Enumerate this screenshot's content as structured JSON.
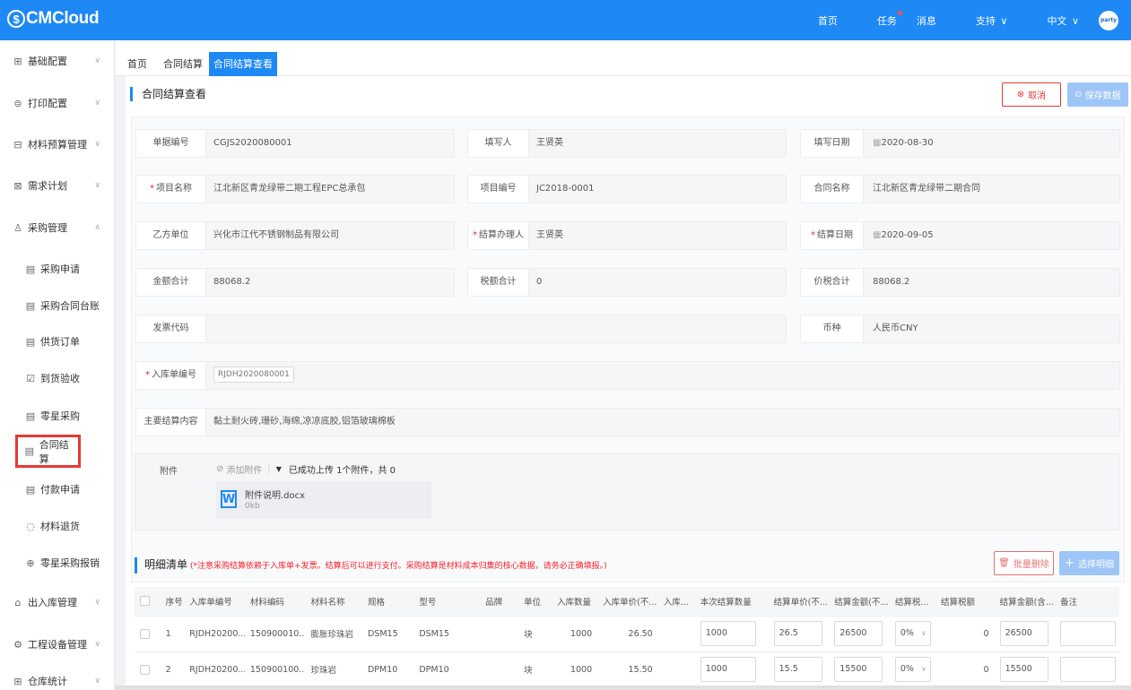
{
  "brand": "CMCloud",
  "topnav": {
    "home": "首页",
    "tasks": "任务",
    "messages": "消息",
    "support": "支持",
    "language": "中文",
    "avatar_text": "party"
  },
  "sidebar": [
    {
      "label": "基础配置",
      "icon": "grid-icon",
      "arrow": "∨"
    },
    {
      "label": "打印配置",
      "icon": "print-icon",
      "arrow": "∨"
    },
    {
      "label": "材料预算管理",
      "icon": "budget-icon",
      "arrow": "∨"
    },
    {
      "label": "需求计划",
      "icon": "plan-icon",
      "arrow": "∨"
    },
    {
      "label": "采购管理",
      "icon": "purchase-icon",
      "arrow": "∧"
    },
    {
      "label": "采购申请",
      "icon": "doc-icon"
    },
    {
      "label": "采购合同台账",
      "icon": "doc-icon"
    },
    {
      "label": "供货订单",
      "icon": "doc-icon"
    },
    {
      "label": "到货验收",
      "icon": "check-icon"
    },
    {
      "label": "零星采购",
      "icon": "doc-icon"
    },
    {
      "label": "合同结算",
      "icon": "doc-icon"
    },
    {
      "label": "付款申请",
      "icon": "doc-icon"
    },
    {
      "label": "材料退货",
      "icon": "return-icon"
    },
    {
      "label": "零星采购报销",
      "icon": "reimburse-icon"
    },
    {
      "label": "出入库管理",
      "icon": "warehouse-icon",
      "arrow": "∨"
    },
    {
      "label": "工程设备管理",
      "icon": "equipment-icon",
      "arrow": "∨"
    },
    {
      "label": "仓库统计",
      "icon": "stats-icon",
      "arrow": "∨"
    }
  ],
  "tabs": [
    "首页",
    "合同结算",
    "合同结算查看"
  ],
  "page_title": "合同结算查看",
  "buttons": {
    "cancel": "取消",
    "save": "保存数据",
    "batch_delete": "批量删除",
    "select_detail": "选择明细"
  },
  "form": {
    "doc_no": {
      "label": "单据编号",
      "value": "CGJS2020080001"
    },
    "filler": {
      "label": "填写人",
      "value": "王贤英"
    },
    "fill_date": {
      "label": "填写日期",
      "value": "2020-08-30"
    },
    "project_name": {
      "label": "项目名称",
      "value": "江北新区青龙绿带二期工程EPC总承包"
    },
    "project_no": {
      "label": "项目编号",
      "value": "JC2018-0001"
    },
    "contract_name": {
      "label": "合同名称",
      "value": "江北新区青龙绿带二期合同"
    },
    "party_b": {
      "label": "乙方单位",
      "value": "兴化市江代不锈钢制品有限公司"
    },
    "handler": {
      "label": "结算办理人",
      "value": "王贤英"
    },
    "settle_date": {
      "label": "结算日期",
      "value": "2020-09-05"
    },
    "amount_total": {
      "label": "金额合计",
      "value": "88068.2"
    },
    "tax_total": {
      "label": "税额合计",
      "value": "0"
    },
    "price_tax_total": {
      "label": "价税合计",
      "value": "88068.2"
    },
    "invoice_code": {
      "label": "发票代码",
      "value": ""
    },
    "currency": {
      "label": "币种",
      "value": "人民币CNY"
    },
    "inbound_no": {
      "label": "入库单编号",
      "value": "RJDH2020080001"
    },
    "content": {
      "label": "主要结算内容",
      "value": "黏土耐火砖,珊砂,海绵,凉凉底胶,铝箔玻璃棉板"
    },
    "attachment": {
      "label": "附件",
      "add": "添加附件",
      "status": "已成功上传 1个附件，共 0",
      "file_name": "附件说明.docx",
      "file_size": "0kb"
    }
  },
  "detail": {
    "title": "明细清单",
    "note": "(*注意采购结算依赖于入库单+发票。结算后可以进行支付。采购结算是材料成本归集的核心数据，请务必正确填报。)",
    "columns": [
      "序号",
      "入库单编号",
      "材料编码",
      "材料名称",
      "规格",
      "型号",
      "品牌",
      "单位",
      "入库数量",
      "入库单价(不...",
      "入库...",
      "本次结算数量",
      "结算单价(不...",
      "结算金额(不...",
      "结算税...",
      "结算税额",
      "结算金额(含...",
      "备注"
    ],
    "rows": [
      {
        "no": "1",
        "inbound": "RJDH20200...",
        "code": "150900010...",
        "name": "膨胀珍珠岩",
        "spec": "DSM15",
        "model": "DSM15",
        "brand": "",
        "unit": "块",
        "qty": "1000",
        "price": "26.50",
        "in_amt": "",
        "settle_qty": "1000",
        "settle_price": "26.5",
        "settle_amt": "26500",
        "tax_rate": "0%",
        "tax": "0",
        "settle_amt_tax": "26500",
        "remark": ""
      },
      {
        "no": "2",
        "inbound": "RJDH20200...",
        "code": "150900100...",
        "name": "珍珠岩",
        "spec": "DPM10",
        "model": "DPM10",
        "brand": "",
        "unit": "块",
        "qty": "1000",
        "price": "15.50",
        "in_amt": "",
        "settle_qty": "1000",
        "settle_price": "15.5",
        "settle_amt": "15500",
        "tax_rate": "0%",
        "tax": "0",
        "settle_amt_tax": "15500",
        "remark": ""
      }
    ]
  }
}
